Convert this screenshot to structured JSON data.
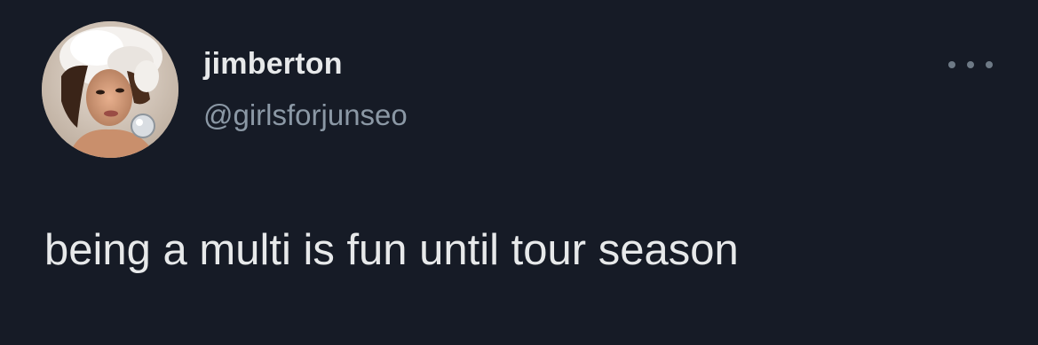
{
  "tweet": {
    "display_name": "jimberton",
    "handle": "@girlsforjunseo",
    "text": "being a multi is fun until tour season",
    "avatar_icon": "profile-avatar",
    "more_icon": "more-options-icon"
  },
  "colors": {
    "background": "#161b26",
    "primary_text": "#e7e9ea",
    "secondary_text": "#8b98a5"
  }
}
